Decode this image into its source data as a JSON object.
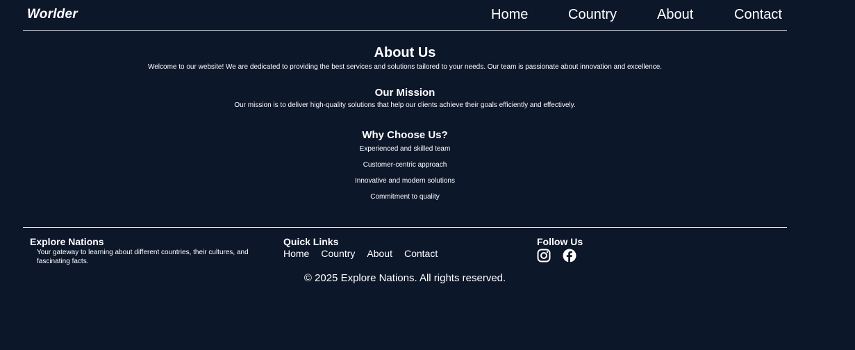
{
  "header": {
    "logo": "Worlder",
    "nav": [
      "Home",
      "Country",
      "About",
      "Contact"
    ]
  },
  "main": {
    "title": "About Us",
    "intro": "Welcome to our website! We are dedicated to providing the best services and solutions tailored to your needs. Our team is passionate about innovation and excellence.",
    "mission_title": "Our Mission",
    "mission_text": "Our mission is to deliver high-quality solutions that help our clients achieve their goals efficiently and effectively.",
    "why_title": "Why Choose Us?",
    "why_items": [
      "Experienced and skilled team",
      "Customer-centric approach",
      "Innovative and modern solutions",
      "Commitment to quality"
    ]
  },
  "footer": {
    "brand_title": "Explore Nations",
    "brand_desc": "Your gateway to learning about different countries, their cultures, and fascinating facts.",
    "quick_links_title": "Quick Links",
    "quick_links": [
      "Home",
      "Country",
      "About",
      "Contact"
    ],
    "follow_title": "Follow Us",
    "social_icons": [
      "instagram-icon",
      "facebook-icon"
    ],
    "copyright": "© 2025 Explore Nations. All rights reserved."
  },
  "colors": {
    "background": "#0d172a",
    "text": "#ffffff",
    "divider": "#e8e8e8"
  }
}
